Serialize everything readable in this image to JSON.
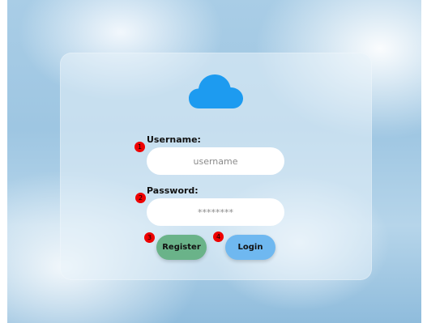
{
  "logo": {
    "icon": "cloud-icon",
    "color": "#1d9bf0"
  },
  "form": {
    "username_label": "Username:",
    "username_placeholder": "username",
    "password_label": "Password:",
    "password_placeholder": "********"
  },
  "buttons": {
    "register_label": "Register",
    "register_color": "#6ab389",
    "login_label": "Login",
    "login_color": "#6fb8f0"
  },
  "markers": {
    "m1": "1",
    "m2": "2",
    "m3": "3",
    "m4": "4",
    "color": "#ee0000"
  }
}
